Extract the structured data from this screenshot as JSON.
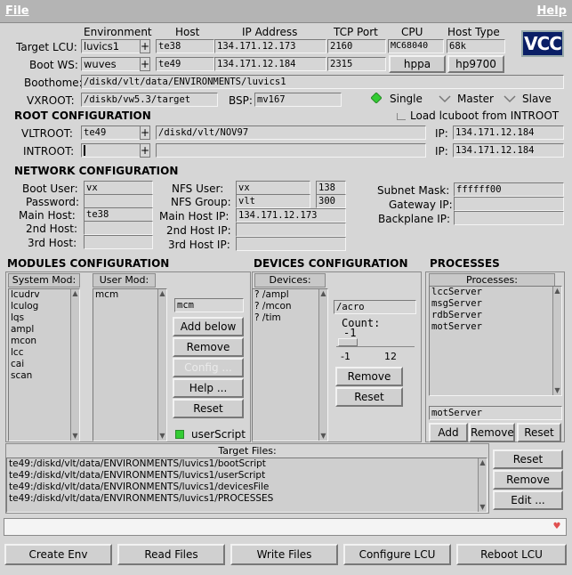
{
  "menu": {
    "file": "File",
    "help": "Help"
  },
  "logo_text": "VCC",
  "columns": {
    "environment": "Environment",
    "host": "Host",
    "ip": "IP Address",
    "tcp": "TCP Port",
    "cpu": "CPU",
    "hosttype": "Host Type"
  },
  "target_lcu": {
    "label": "Target LCU:",
    "env": "luvics1",
    "host": "te38",
    "ip": "134.171.12.173",
    "port": "2160",
    "cpu": "MC68040",
    "hosttype": "68k"
  },
  "boot_ws": {
    "label": "Boot WS:",
    "env": "wuves",
    "host": "te49",
    "ip": "134.171.12.184",
    "port": "2315",
    "cpu": "hppa",
    "hosttype": "hp9700"
  },
  "boothome": {
    "label": "Boothome:",
    "value": "/diskd/vlt/data/ENVIRONMENTS/luvics1"
  },
  "vxroot": {
    "label": "VXROOT:",
    "value": "/diskb/vw5.3/target",
    "bsp_label": "BSP:",
    "bsp": "mv167"
  },
  "mode": {
    "single": "Single",
    "master": "Master",
    "slave": "Slave"
  },
  "root": {
    "title": "ROOT CONFIGURATION",
    "load_label": "Load lcuboot from INTROOT",
    "vltroot_label": "VLTROOT:",
    "vltroot_host": "te49",
    "vltroot_path": "/diskd/vlt/NOV97",
    "introot_label": "INTROOT:",
    "introot_host": "",
    "introot_path": "",
    "ip_label": "IP:",
    "ip1": "134.171.12.184",
    "ip2": "134.171.12.184"
  },
  "network": {
    "title": "NETWORK CONFIGURATION",
    "boot_user_label": "Boot User:",
    "boot_user": "vx",
    "password_label": "Password:",
    "password": "",
    "main_host_label": "Main Host:",
    "main_host": "te38",
    "host2_label": "2nd Host:",
    "host2": "",
    "host3_label": "3rd Host:",
    "host3": "",
    "nfs_user_label": "NFS User:",
    "nfs_user": "vx",
    "nfs_user_id": "138",
    "nfs_group_label": "NFS Group:",
    "nfs_group": "vlt",
    "nfs_group_id": "300",
    "main_ip_label": "Main Host IP:",
    "main_ip": "134.171.12.173",
    "ip2_label": "2nd Host IP:",
    "ip2": "",
    "ip3_label": "3rd Host IP:",
    "ip3": "",
    "subnet_label": "Subnet Mask:",
    "subnet": "ffffff00",
    "gateway_label": "Gateway IP:",
    "gateway": "",
    "backplane_label": "Backplane IP:",
    "backplane": ""
  },
  "modules": {
    "title": "MODULES CONFIGURATION",
    "system_head": "System Mod:",
    "user_head": "User Mod:",
    "system_items": [
      "lcudrv",
      "lculog",
      "lqs",
      "ampl",
      "mcon",
      "lcc",
      "cai",
      "scan"
    ],
    "user_items": [
      "mcm"
    ],
    "entry": "mcm",
    "add_below": "Add below",
    "remove": "Remove",
    "config": "Config ...",
    "help": "Help ...",
    "reset": "Reset",
    "userscript": "userScript"
  },
  "devices": {
    "title": "DEVICES CONFIGURATION",
    "head": "Devices:",
    "items": [
      "? /ampl",
      "? /mcon",
      "? /tim"
    ],
    "entry": "/acro",
    "count_label": "Count:",
    "count_value": "-1",
    "scale_min": "-1",
    "scale_max": "12",
    "remove": "Remove",
    "reset": "Reset"
  },
  "processes": {
    "title": "PROCESSES",
    "head": "Processes:",
    "items": [
      "lccServer",
      "msgServer",
      "rdbServer",
      "motServer"
    ],
    "entry": "motServer",
    "add": "Add",
    "remove": "Remove",
    "reset": "Reset"
  },
  "target_files": {
    "head": "Target Files:",
    "items": [
      "te49:/diskd/vlt/data/ENVIRONMENTS/luvics1/bootScript",
      "te49:/diskd/vlt/data/ENVIRONMENTS/luvics1/userScript",
      "te49:/diskd/vlt/data/ENVIRONMENTS/luvics1/devicesFile",
      "te49:/diskd/vlt/data/ENVIRONMENTS/luvics1/PROCESSES"
    ],
    "reset": "Reset",
    "remove": "Remove",
    "edit": "Edit ..."
  },
  "status": "",
  "bottom": {
    "create": "Create Env",
    "read": "Read Files",
    "write": "Write Files",
    "configure": "Configure LCU",
    "reboot": "Reboot LCU"
  },
  "colors": {
    "menubar": "#b4b4b4",
    "indicator_green": "#33cc33",
    "status_dot": "#ff6666"
  }
}
